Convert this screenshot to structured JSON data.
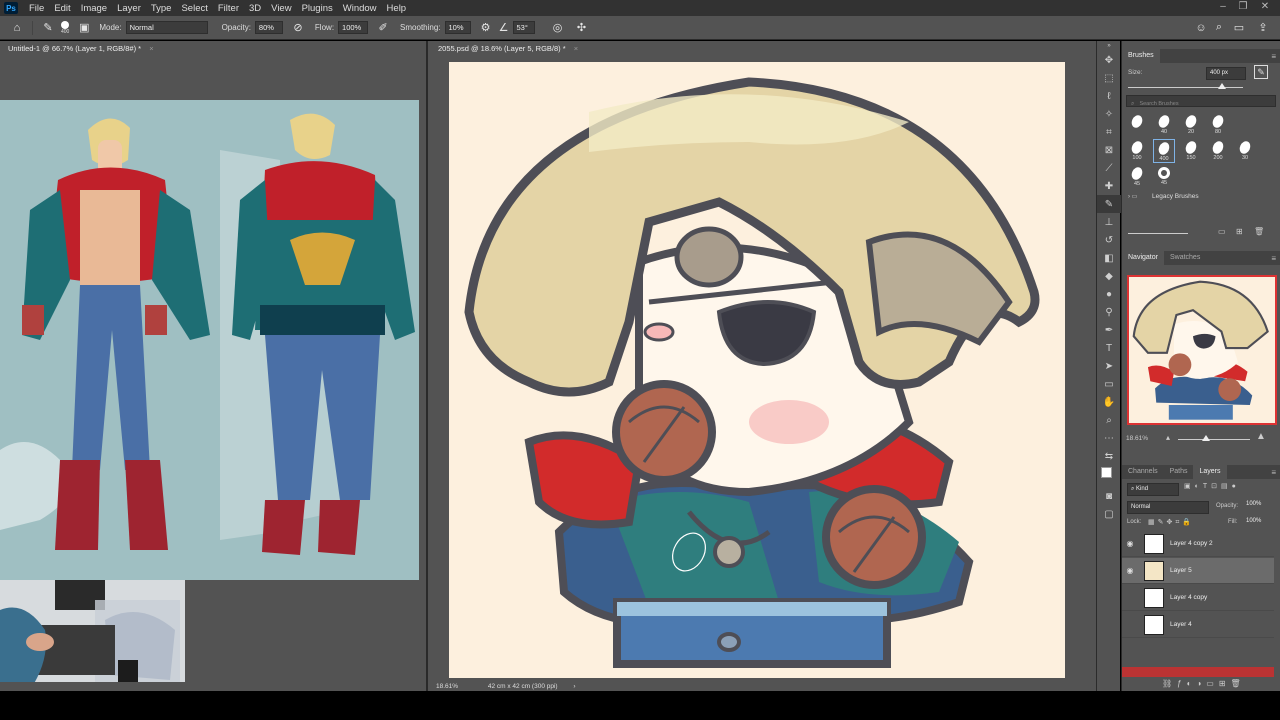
{
  "menu": [
    "File",
    "Edit",
    "Image",
    "Layer",
    "Type",
    "Select",
    "Filter",
    "3D",
    "View",
    "Plugins",
    "Window",
    "Help"
  ],
  "options": {
    "brush_size": "400",
    "mode_label": "Mode:",
    "mode_value": "Normal",
    "opacity_label": "Opacity:",
    "opacity_value": "80%",
    "flow_label": "Flow:",
    "flow_value": "100%",
    "smoothing_label": "Smoothing:",
    "smoothing_value": "10%",
    "angle_value": "53°"
  },
  "tabs": {
    "left": "Untitled-1 @ 66.7% (Layer 1, RGB/8#) *",
    "right": "2055.psd @ 18.6% (Layer 5, RGB/8) *"
  },
  "status": {
    "left_zoom": "18.61%",
    "doc_size": "42 cm x 42 cm (300 ppi)"
  },
  "brushes": {
    "title": "Brushes",
    "size_label": "Size:",
    "size_value": "400 px",
    "search_placeholder": "Search Brushes",
    "presets": [
      {
        "num": "",
        "row": 0,
        "col": 0
      },
      {
        "num": "40",
        "row": 0,
        "col": 1
      },
      {
        "num": "20",
        "row": 0,
        "col": 2
      },
      {
        "num": "80",
        "row": 0,
        "col": 3
      },
      {
        "num": "100",
        "row": 1,
        "col": 0
      },
      {
        "num": "400",
        "row": 1,
        "col": 1
      },
      {
        "num": "150",
        "row": 1,
        "col": 2
      },
      {
        "num": "200",
        "row": 1,
        "col": 3
      },
      {
        "num": "30",
        "row": 1,
        "col": 4
      },
      {
        "num": "45",
        "row": 2,
        "col": 0
      },
      {
        "num": "45",
        "row": 2,
        "col": 1
      }
    ],
    "legacy_label": "Legacy Brushes"
  },
  "navigator": {
    "tab": "Navigator",
    "tab2": "Swatches",
    "zoom": "18.61%"
  },
  "layers": {
    "tabs": [
      "Channels",
      "Paths",
      "Layers"
    ],
    "kind_label": "Kind",
    "blend_mode": "Normal",
    "opacity_label": "Opacity:",
    "opacity_value": "100%",
    "lock_label": "Lock:",
    "fill_label": "Fill:",
    "fill_value": "100%",
    "items": [
      {
        "name": "Layer 4 copy 2",
        "visible": true,
        "selected": false
      },
      {
        "name": "Layer 5",
        "visible": true,
        "selected": true
      },
      {
        "name": "Layer 4 copy",
        "visible": false,
        "selected": false
      },
      {
        "name": "Layer 4",
        "visible": false,
        "selected": false
      }
    ]
  }
}
